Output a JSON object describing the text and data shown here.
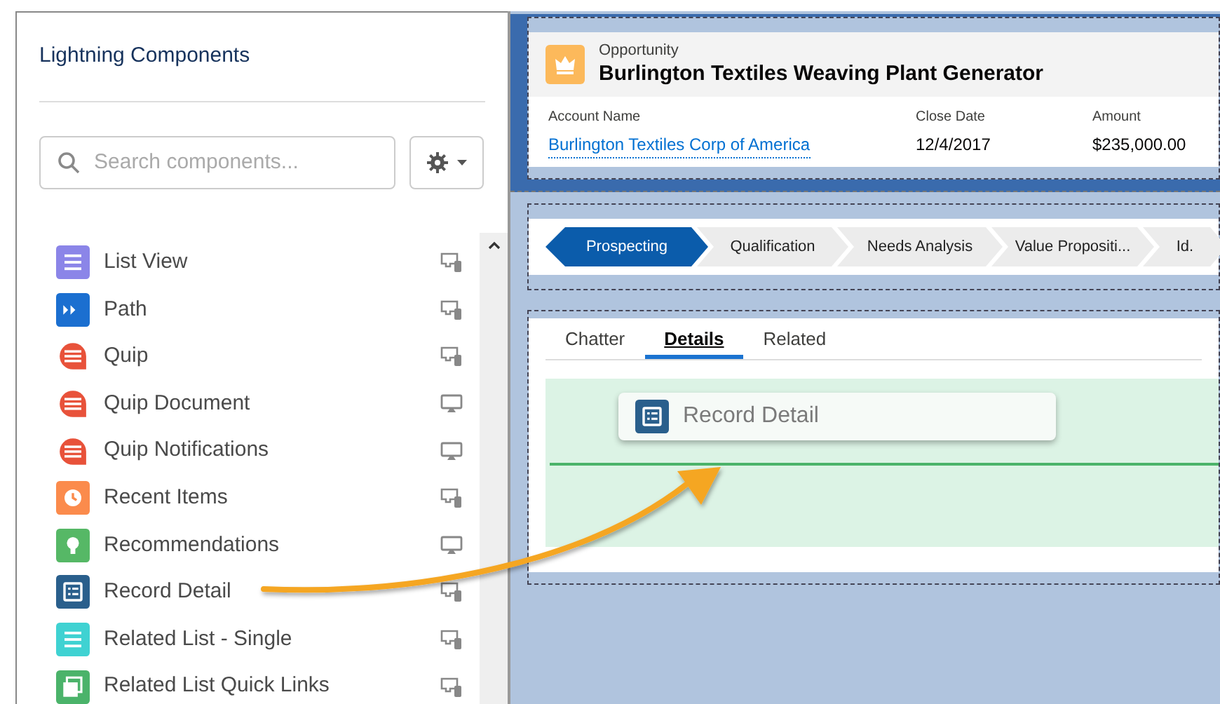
{
  "sidebar": {
    "title": "Lightning Components",
    "search": {
      "placeholder": "Search components..."
    },
    "components": [
      {
        "label": "List View",
        "kind": "list",
        "color": "#8b85e8",
        "mobile": true
      },
      {
        "label": "Path",
        "kind": "path",
        "color": "#1b6fd0",
        "mobile": true
      },
      {
        "label": "Quip",
        "kind": "quip",
        "color": "#e8523a",
        "mobile": true
      },
      {
        "label": "Quip Document",
        "kind": "quip",
        "color": "#e8523a",
        "mobile": false
      },
      {
        "label": "Quip Notifications",
        "kind": "quip",
        "color": "#e8523a",
        "mobile": false
      },
      {
        "label": "Recent Items",
        "kind": "clock",
        "color": "#fb8b4c",
        "mobile": true
      },
      {
        "label": "Recommendations",
        "kind": "bulb",
        "color": "#56b866",
        "mobile": false
      },
      {
        "label": "Record Detail",
        "kind": "detail",
        "color": "#2a5f8c",
        "mobile": true
      },
      {
        "label": "Related List - Single",
        "kind": "list",
        "color": "#3fd2d2",
        "mobile": true
      },
      {
        "label": "Related List Quick Links",
        "kind": "stack",
        "color": "#4bb36a",
        "mobile": true
      }
    ]
  },
  "record": {
    "object": "Opportunity",
    "name": "Burlington Textiles Weaving Plant Generator",
    "fields": [
      {
        "label": "Account Name",
        "value": "Burlington Textiles Corp of America",
        "kind": "link"
      },
      {
        "label": "Close Date",
        "value": "12/4/2017",
        "kind": "text"
      },
      {
        "label": "Amount",
        "value": "$235,000.00",
        "kind": "text"
      }
    ]
  },
  "path": [
    {
      "label": "Prospecting",
      "selected": true
    },
    {
      "label": "Qualification",
      "selected": false
    },
    {
      "label": "Needs Analysis",
      "selected": false
    },
    {
      "label": "Value Propositi...",
      "selected": false
    },
    {
      "label": "Id.",
      "selected": false
    }
  ],
  "tabs": [
    {
      "label": "Chatter",
      "selected": false
    },
    {
      "label": "Details",
      "selected": true
    },
    {
      "label": "Related",
      "selected": false
    }
  ],
  "dragged_component": {
    "label": "Record Detail",
    "kind": "detail",
    "color": "#2a5f8c"
  }
}
